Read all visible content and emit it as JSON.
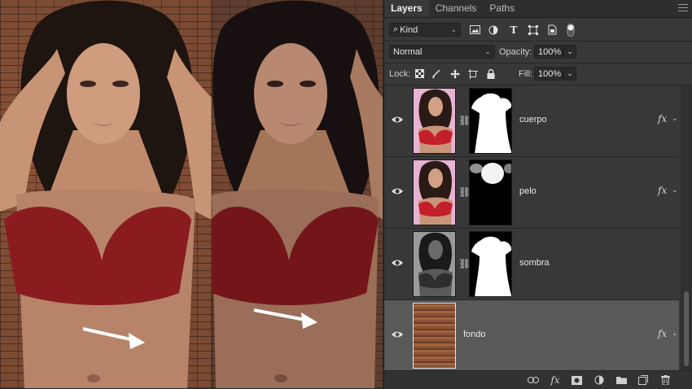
{
  "panel": {
    "tabs": [
      {
        "label": "Layers"
      },
      {
        "label": "Channels"
      },
      {
        "label": "Paths"
      }
    ],
    "filter": {
      "kind_label": "Kind"
    },
    "blend_mode": "Normal",
    "opacity_label": "Opacity:",
    "opacity_value": "100%",
    "lock_label": "Lock:",
    "fill_label": "Fill:",
    "fill_value": "100%",
    "layers": [
      {
        "name": "cuerpo",
        "visible": true,
        "has_mask": true,
        "has_fx": true,
        "selected": false
      },
      {
        "name": "pelo",
        "visible": true,
        "has_mask": true,
        "has_fx": true,
        "selected": false
      },
      {
        "name": "sombra",
        "visible": true,
        "has_mask": true,
        "has_fx": false,
        "selected": false
      },
      {
        "name": "fondo",
        "visible": true,
        "has_mask": false,
        "has_fx": true,
        "selected": true
      }
    ],
    "fx_label": "fx"
  },
  "colors": {
    "panel_bg": "#383838",
    "selected_layer": "#595959",
    "bra_red": "#8a1c1f",
    "brick": "#7a4a33"
  },
  "icons": [
    "filter-image-icon",
    "adjustment-icon",
    "type-icon",
    "shape-icon",
    "smart-object-icon",
    "filter-toggle-icon",
    "lock-pixels-icon",
    "lock-paint-icon",
    "lock-move-icon",
    "lock-artboard-icon",
    "lock-all-icon",
    "link-layers-icon",
    "add-style-icon",
    "add-mask-icon",
    "new-adjustment-icon",
    "new-group-icon",
    "new-layer-icon",
    "delete-icon"
  ]
}
